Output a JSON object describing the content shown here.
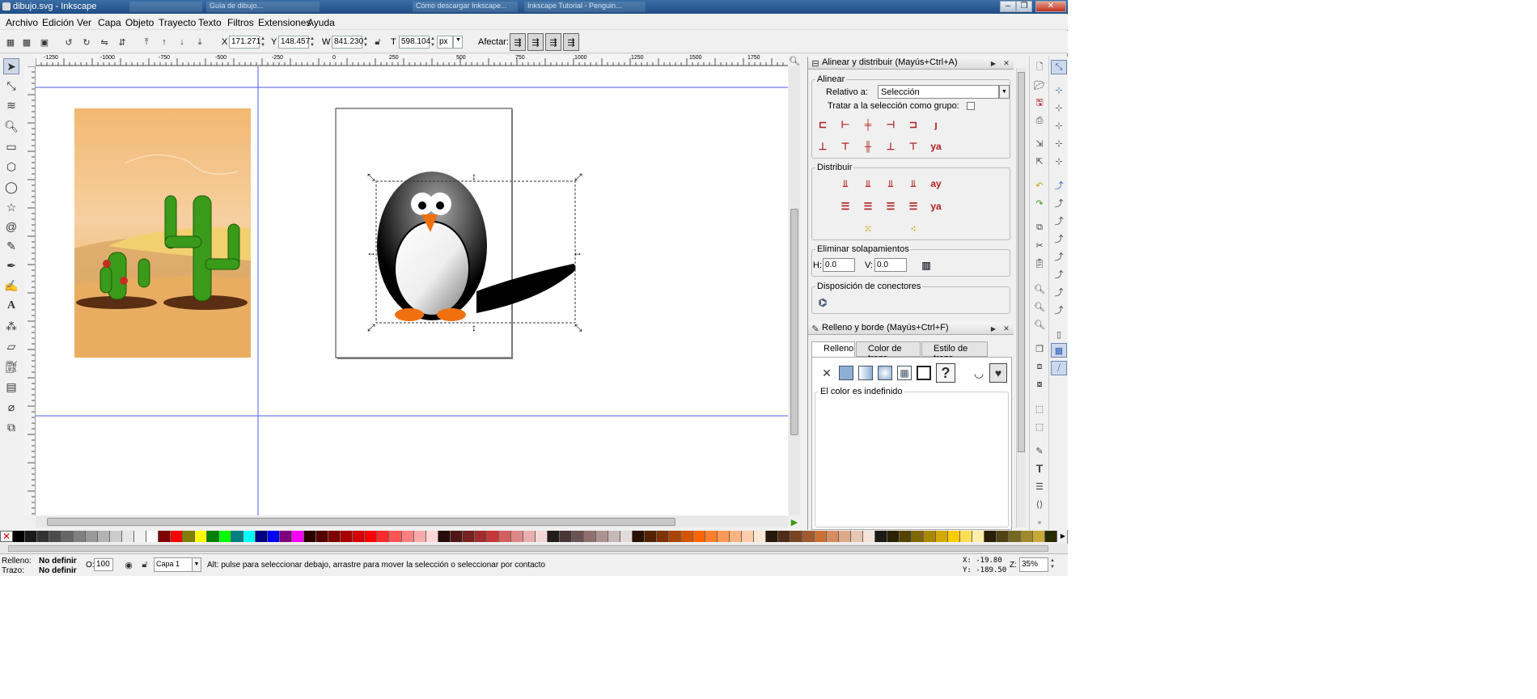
{
  "window": {
    "title": "dibujo.svg - Inkscape",
    "ghost_tabs": [
      "",
      "Guía de dibujo...",
      "Cómo descargar Inkscape...",
      "Inkscape Tutorial - Penguin..."
    ]
  },
  "menu": [
    "Archivo",
    "Edición",
    "Ver",
    "Capa",
    "Objeto",
    "Trayecto",
    "Texto",
    "Filtros",
    "Extensiones",
    "Ayuda"
  ],
  "toolbar": {
    "x_label": "X",
    "x_value": "171.271",
    "y_label": "Y",
    "y_value": "148.457",
    "w_label": "W",
    "w_value": "841.230",
    "h_label": "T",
    "h_value": "598.104",
    "unit": "px",
    "affect_label": "Afectar:"
  },
  "ruler": {
    "ticks": [
      "-1250",
      "-1000",
      "-750",
      "-500",
      "-250",
      "0",
      "250",
      "500",
      "750",
      "1000",
      "1250",
      "1500",
      "1750"
    ]
  },
  "align_panel": {
    "title": "Alinear y distribuir (Mayús+Ctrl+A)",
    "align_label": "Alinear",
    "relative_label": "Relativo a:",
    "relative_value": "Selección",
    "group_label": "Tratar a la selección como grupo:",
    "distribute_label": "Distribuir",
    "overlap_label": "Eliminar solapamientos",
    "h_label": "H:",
    "h_value": "0.0",
    "v_label": "V:",
    "v_value": "0.0",
    "connectors_label": "Disposición de conectores"
  },
  "fill_panel": {
    "title": "Relleno y borde (Mayús+Ctrl+F)",
    "tab_fill": "Relleno",
    "tab_stroke_color": "Color de trazo",
    "tab_stroke_style": "Estilo de trazo",
    "undefined_label": "El color es indefinido",
    "unknown_glyph": "?"
  },
  "palette": [
    "#000000",
    "#1a1a1a",
    "#333333",
    "#4d4d4d",
    "#666666",
    "#808080",
    "#999999",
    "#b3b3b3",
    "#cccccc",
    "#e6e6e6",
    "#f2f2f2",
    "#ffffff",
    "#800000",
    "#ff0000",
    "#808000",
    "#ffff00",
    "#008000",
    "#00ff00",
    "#008080",
    "#00ffff",
    "#000080",
    "#0000ff",
    "#800080",
    "#ff00ff",
    "#2b0000",
    "#550000",
    "#800000",
    "#aa0000",
    "#d40000",
    "#ff0000",
    "#ff2a2a",
    "#ff5555",
    "#ff8080",
    "#ffaaaa",
    "#ffd5d5",
    "#280b0b",
    "#501616",
    "#782121",
    "#a02c2c",
    "#c83737",
    "#d35f5f",
    "#de8787",
    "#e9afaf",
    "#f4d7d7",
    "#241c1c",
    "#483737",
    "#6c5353",
    "#916f6f",
    "#ac9393",
    "#c8b7b7",
    "#e3dbdb",
    "#2b1100",
    "#552200",
    "#803300",
    "#aa4400",
    "#d45500",
    "#ff6600",
    "#ff7f2a",
    "#ff9955",
    "#ffb380",
    "#ffccaa",
    "#ffe6d5",
    "#28170b",
    "#502d16",
    "#784421",
    "#a05a2c",
    "#c87137",
    "#d38d5f",
    "#deaa87",
    "#e9c6af",
    "#f4e3d7",
    "#1c1a17",
    "#2b2200",
    "#554400",
    "#806600",
    "#aa8800",
    "#d4aa00",
    "#ffcc00",
    "#ffdd55",
    "#ffeeaa",
    "#282000",
    "#504416",
    "#786721",
    "#a0892c",
    "#c8ab37",
    "#2b2b00"
  ],
  "status": {
    "fill_label": "Relleno:",
    "fill_value": "No definir",
    "stroke_label": "Trazo:",
    "stroke_value": "No definir",
    "opacity_label": "O:",
    "opacity_value": "100",
    "layer": "Capa 1",
    "message": "Alt: pulse para seleccionar debajo, arrastre para mover la selección o seleccionar por contacto",
    "cursor_x": "X: -19.80",
    "cursor_y": "Y: -189.50",
    "zoom_label": "Z:",
    "zoom_value": "35%"
  },
  "colors": {
    "guide": "#4a5de0",
    "sand": "#f2c080",
    "cactus": "#3a9a1a"
  }
}
